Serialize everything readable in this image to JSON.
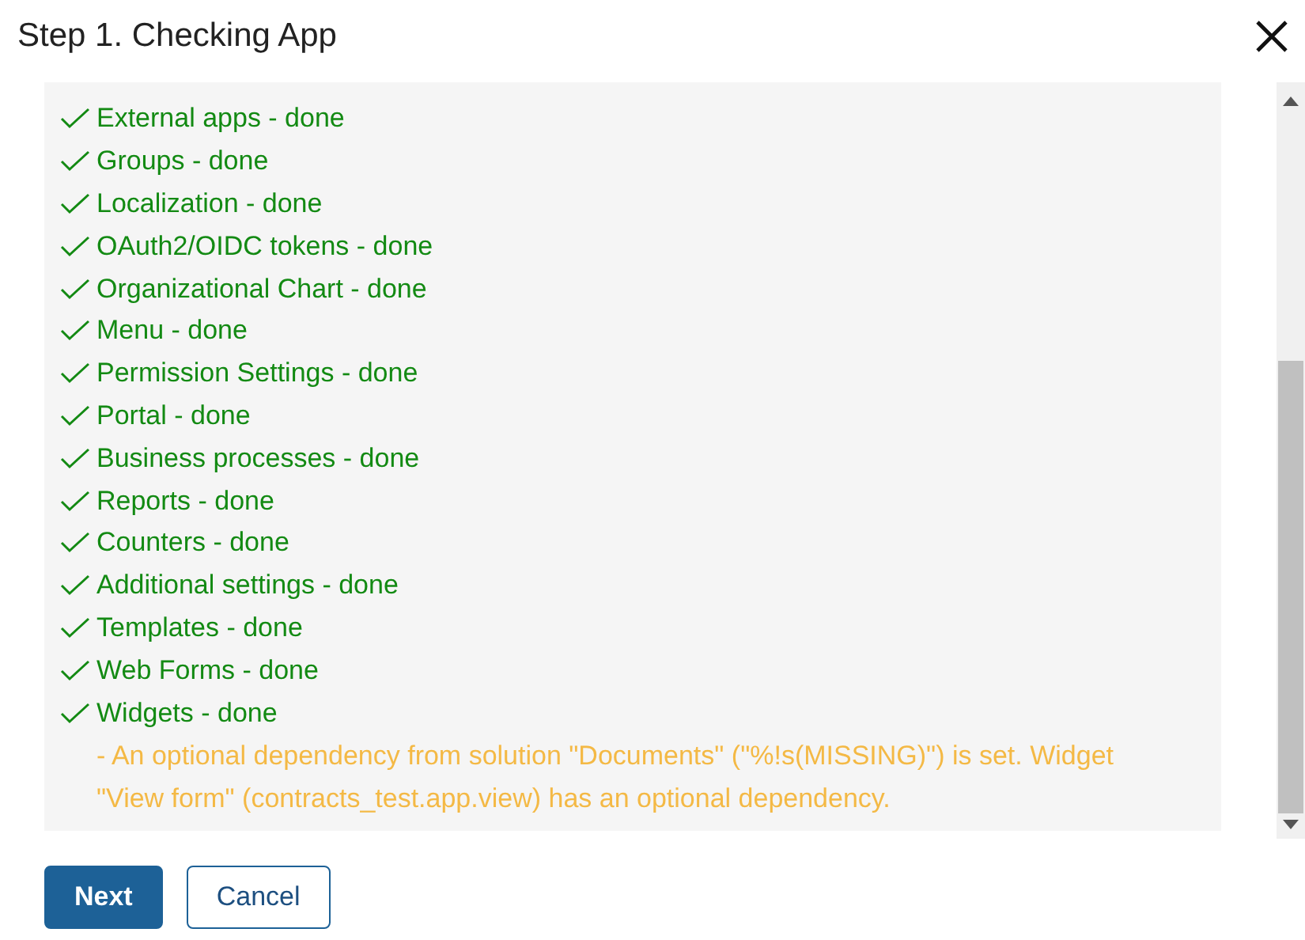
{
  "dialog": {
    "title": "Step 1. Checking App"
  },
  "checks": [
    {
      "kind": "done",
      "label": "External apps - done"
    },
    {
      "kind": "done",
      "label": "Groups - done"
    },
    {
      "kind": "done",
      "label": "Localization - done"
    },
    {
      "kind": "done",
      "label": "OAuth2/OIDC tokens - done"
    },
    {
      "kind": "done",
      "label": "Organizational Chart - done"
    },
    {
      "kind": "done",
      "label": "Menu - done"
    },
    {
      "kind": "done",
      "label": "Permission Settings - done"
    },
    {
      "kind": "done",
      "label": "Portal - done"
    },
    {
      "kind": "done",
      "label": "Business processes - done"
    },
    {
      "kind": "done",
      "label": "Reports - done"
    },
    {
      "kind": "done",
      "label": "Counters - done"
    },
    {
      "kind": "done",
      "label": "Additional settings - done"
    },
    {
      "kind": "done",
      "label": "Templates - done"
    },
    {
      "kind": "done",
      "label": "Web Forms - done"
    },
    {
      "kind": "done",
      "label": "Widgets - done"
    },
    {
      "kind": "warning",
      "label": "- An optional dependency from solution \"Documents\" (\"%!s(MISSING)\") is set. Widget \"View form\" (contracts_test.app.view) has an optional dependency."
    }
  ],
  "buttons": [
    {
      "kind": "primary",
      "label": "Next"
    },
    {
      "kind": "secondary",
      "label": "Cancel"
    }
  ]
}
